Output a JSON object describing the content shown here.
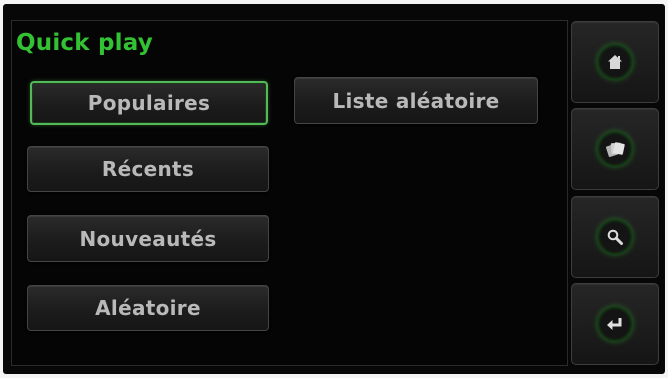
{
  "screen": {
    "title": "Quick play"
  },
  "menu": {
    "items": [
      {
        "label": "Populaires",
        "selected": true
      },
      {
        "label": "Récents",
        "selected": false
      },
      {
        "label": "Nouveautés",
        "selected": false
      },
      {
        "label": "Aléatoire",
        "selected": false
      },
      {
        "label": "Liste aléatoire",
        "selected": false
      }
    ]
  },
  "sidebar": {
    "buttons": [
      {
        "icon": "home-icon"
      },
      {
        "icon": "cards-icon"
      },
      {
        "icon": "search-icon"
      },
      {
        "icon": "enter-icon"
      }
    ]
  },
  "colors": {
    "accent": "#33c233",
    "selection_border": "#55b95a",
    "button_text": "#b9b9b9",
    "background": "#070707"
  }
}
